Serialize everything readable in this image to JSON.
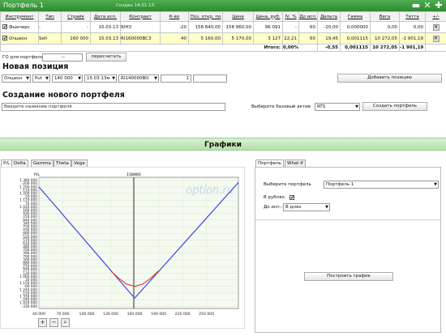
{
  "window": {
    "title": "Портфель 1",
    "subtitle": "Создан 14.01.13",
    "btn_min": "▬",
    "btn_close": "✕",
    "btn_add": "✚"
  },
  "table": {
    "headers": [
      "Инструмент",
      "Тип",
      "Страйк",
      "Дата исп.",
      "Контракт",
      "К-во",
      "Поз. откр. по",
      "Цена",
      "Цена, руб.",
      "IV, %",
      "До исп.",
      "Дельта",
      "Гамма",
      "Вега",
      "Тетта",
      "+/-"
    ],
    "rows": [
      {
        "check": "✔",
        "cells": [
          "Фьючерс",
          "-",
          "-",
          "15.03.13",
          "RIH3",
          "-20",
          "158 840,00",
          "158 860,00",
          "96 091",
          "-",
          "60",
          "-20,00",
          "0,000000",
          "0,00",
          "0,00"
        ]
      },
      {
        "check": "✔",
        "cells": [
          "Опцион",
          "Sell",
          "160 000",
          "15.03.13",
          "RI160000BC3",
          "40",
          "5 160,00",
          "5 170,00",
          "3 127",
          "22,21",
          "60",
          "19,45",
          "0,001115",
          "10 272,05",
          "-1 901,19"
        ]
      }
    ],
    "totals": {
      "label": "Итого:",
      "pct": "0,00%",
      "delta": "-0,55",
      "gamma": "0,001115",
      "vega": "10 272,05",
      "theta": "-1 901,19"
    }
  },
  "go": {
    "label": "ГО для портфеля:",
    "value": "--",
    "button": "пересчитать"
  },
  "new_position": {
    "heading": "Новая позиция",
    "type": "Опцион",
    "kind": "Put",
    "strike": "140 000",
    "date": "15.03.13м",
    "contract": "RI140000BO",
    "qty": "1",
    "add_button": "Добавить позицию"
  },
  "new_portfolio": {
    "heading": "Создание нового портфеля",
    "name_placeholder": "Введите название портфеля",
    "asset_label": "Выберите базовый актив",
    "asset": "RTS",
    "create_button": "Создать портфель"
  },
  "charts": {
    "bar_title": "Графики",
    "tabs": [
      "P/L",
      "Delta",
      "Gamma",
      "Theta",
      "Vega"
    ],
    "right_tabs": [
      "Портфель",
      "What if"
    ]
  },
  "right_panel": {
    "portfolio_label": "Выберите портфель",
    "portfolio": "Портфель 1",
    "rub_label": "В рублях:",
    "rub_check": "✔",
    "until_label": "До исп.:",
    "until_value": "В днях",
    "build_button": "Построить график"
  },
  "chart_data": {
    "type": "line",
    "ylabel": "P/L",
    "watermark": "option.ru",
    "marker_label": "158860",
    "marker_x": 158860,
    "xlim": [
      40000,
      290000
    ],
    "ylim": [
      -360000,
      1420000
    ],
    "x_ticks": [
      40000,
      70000,
      100000,
      130000,
      160000,
      190000,
      220000,
      250000
    ],
    "x_tick_labels": [
      "40 000",
      "70 000",
      "100 000",
      "130 000",
      "160 000",
      "190 000",
      "220 000",
      "250 000"
    ],
    "y_ticks": [
      -330000,
      -240000,
      -150000,
      -60000,
      30000,
      120000,
      210000,
      300000,
      390000,
      480000,
      570000,
      660000,
      750000,
      840000,
      930000,
      1020000,
      1110000,
      1200000,
      1290000,
      1380000
    ],
    "y_tick_labels": [
      "-330 000",
      "-240 000",
      "-150 000",
      "-60 000",
      "30 000",
      "120 000",
      "210 000",
      "300 000",
      "390 000",
      "480 000",
      "570 000",
      "660 000",
      "750 000",
      "840 000",
      "930 000",
      "1 020 000",
      "1 110 000",
      "1 200 000",
      "1 290 000",
      "1 380 000"
    ],
    "y_tick_labels_extra": [
      "1 420 000",
      "1 330 000",
      "1 240 000",
      "1 150 000",
      "1 060 000",
      "970 000",
      "880 000",
      "790 000",
      "700 000",
      "610 000",
      "520 000",
      "430 000",
      "340 000",
      "250 000",
      "160 000",
      "70 000",
      "-20 000",
      "-110 000",
      "-200 000",
      "-290 000"
    ],
    "series": [
      {
        "color": "#4444dd",
        "x": [
          40000,
          160000,
          290000
        ],
        "y": [
          1290000,
          -220000,
          1350000
        ]
      },
      {
        "color": "#dd4444",
        "x": [
          130000,
          140000,
          150000,
          160000,
          170000,
          180000,
          190000
        ],
        "y": [
          150000,
          50000,
          -30000,
          -60000,
          -30000,
          50000,
          150000
        ]
      }
    ],
    "grid": true
  }
}
